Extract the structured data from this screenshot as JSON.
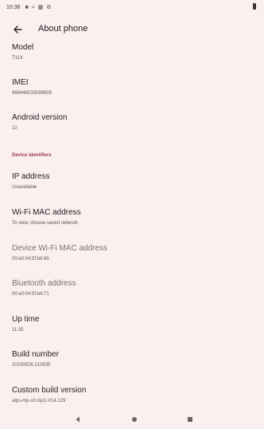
{
  "status_bar": {
    "time": "10:36",
    "icons": [
      "notification-icon",
      "wifi-icon",
      "storage-icon",
      "settings-icon"
    ],
    "battery": "battery-icon"
  },
  "app_bar": {
    "title": "About phone"
  },
  "items": [
    {
      "label": "Model",
      "value": "T11X"
    },
    {
      "label": "IMEI",
      "value": "869448033099905"
    },
    {
      "label": "Android version",
      "value": "12"
    }
  ],
  "section_header": "Device identifiers",
  "identifiers": [
    {
      "label": "IP address",
      "value": "Unavailable"
    },
    {
      "label": "Wi-Fi MAC address",
      "value": "To view, choose saved network"
    },
    {
      "label": "Device Wi-Fi MAC address",
      "value": "00:e0:04:5f:b6:65"
    },
    {
      "label": "Bluetooth address",
      "value": "00:e0:04:5f:b4:71"
    },
    {
      "label": "Up time",
      "value": "11:35"
    },
    {
      "label": "Build number",
      "value": "20230526.210835"
    },
    {
      "label": "Custom build version",
      "value": "alps-mp-s0.mp1-V14.129"
    }
  ],
  "colors": {
    "background": "#fbeff0",
    "section_accent": "#9b3c4a"
  }
}
